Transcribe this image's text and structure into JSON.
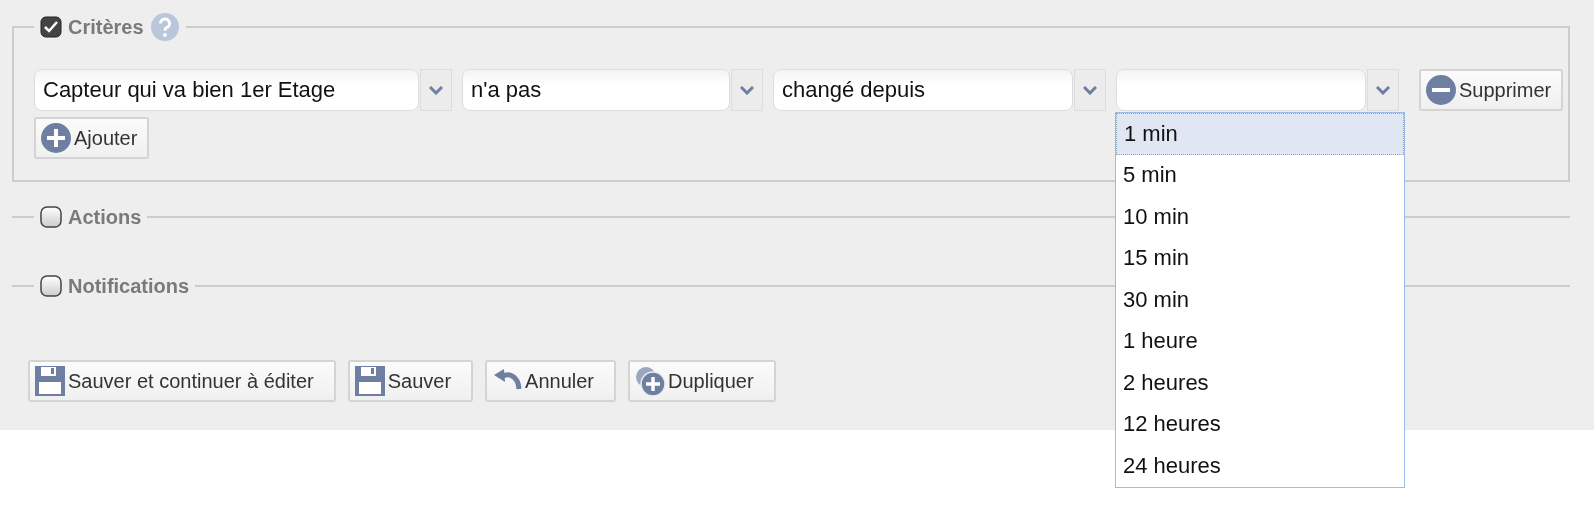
{
  "sections": [
    {
      "label": "Critères",
      "checked": true,
      "help": true,
      "expanded": true
    },
    {
      "label": "Actions",
      "checked": false,
      "expanded": false
    },
    {
      "label": "Notifications",
      "checked": false,
      "expanded": false
    }
  ],
  "criteria": {
    "rows": [
      {
        "combos": [
          {
            "value": "Capteur qui va bien 1er Etage"
          },
          {
            "value": "n'a pas"
          },
          {
            "value": "changé depuis"
          },
          {
            "open": true,
            "options": [
              {
                "label": "1 min",
                "selected": true
              },
              {
                "label": "5 min",
                "selected": false
              },
              {
                "label": "10 min",
                "selected": false
              },
              {
                "label": "15 min",
                "selected": false
              },
              {
                "label": "30 min",
                "selected": false
              },
              {
                "label": "1 heure",
                "selected": false
              },
              {
                "label": "2 heures",
                "selected": false
              },
              {
                "label": "12 heures",
                "selected": false
              },
              {
                "label": "24 heures",
                "selected": false
              }
            ]
          }
        ],
        "remove_button": "Supprimer"
      }
    ],
    "add_button": "Ajouter"
  },
  "buttons": [
    {
      "kind": "save",
      "label": "Sauver et continuer à éditer"
    },
    {
      "kind": "save",
      "label": "Sauver"
    },
    {
      "kind": "undo",
      "label": "Annuler"
    },
    {
      "kind": "duplicate",
      "label": "Dupliquer"
    }
  ]
}
